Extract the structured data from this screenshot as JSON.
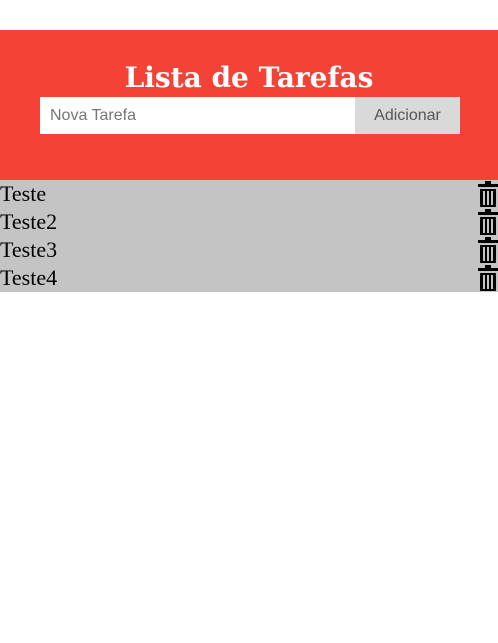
{
  "header": {
    "title": "Lista de Tarefas",
    "input_placeholder": "Nova Tarefa",
    "add_button_label": "Adicionar",
    "background_color": "#f44336"
  },
  "tasks": [
    {
      "label": "Teste",
      "icon": "trash-icon"
    },
    {
      "label": "Teste2",
      "icon": "trash-icon"
    },
    {
      "label": "Teste3",
      "icon": "trash-icon"
    },
    {
      "label": "Teste4",
      "icon": "trash-icon"
    }
  ],
  "list_background_color": "#c4c4c4"
}
